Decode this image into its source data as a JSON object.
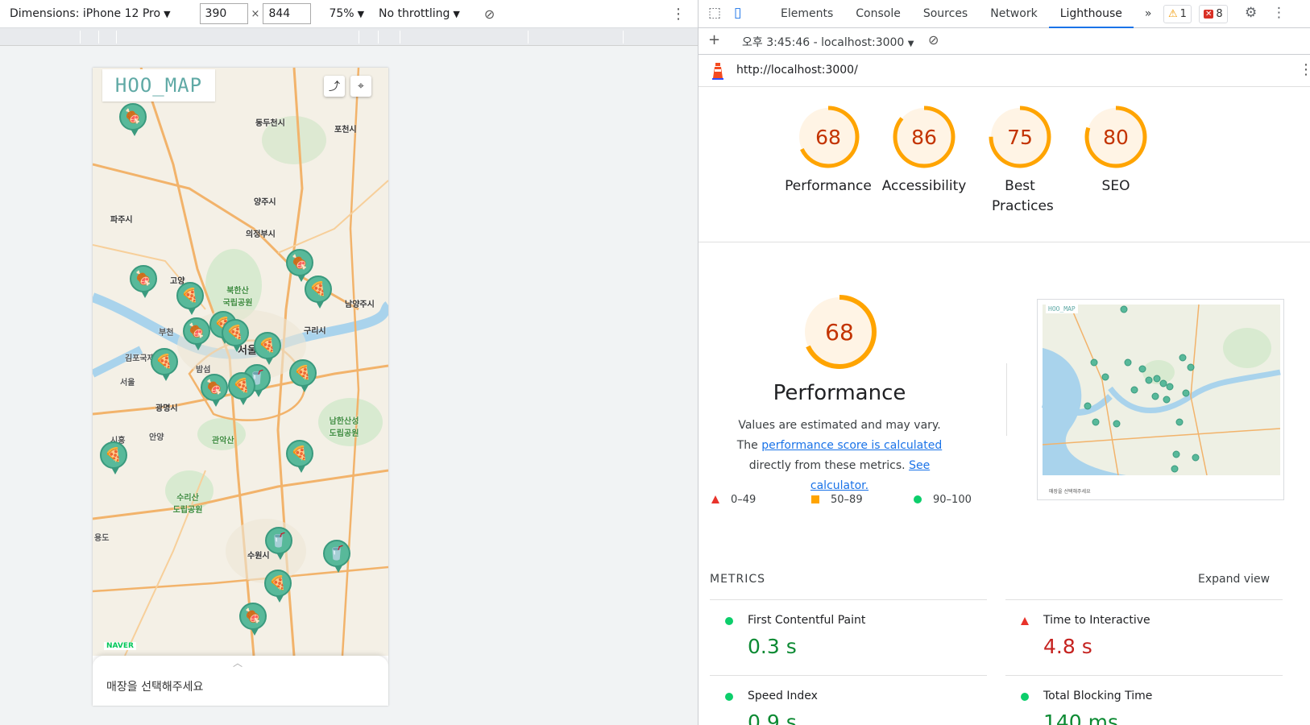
{
  "device_toolbar": {
    "dimensions_label": "Dimensions: iPhone 12 Pro",
    "width_value": "390",
    "height_value": "844",
    "times": "×",
    "zoom": "75%",
    "throttling": "No throttling"
  },
  "app": {
    "logo": "HOO_MAP",
    "share_icon": "share-icon",
    "location_icon": "location-icon",
    "naver_label": "NAVER",
    "bottom_sheet_message": "매장을 선택해주세요",
    "map_places": [
      "동두천시",
      "포천시",
      "양주시",
      "파주시",
      "의정부시",
      "고양",
      "북한산 국립공원",
      "남양주시",
      "구리시",
      "서울",
      "김포국제공항",
      "밤섬",
      "광명시",
      "관악산",
      "남한산성 도립공원",
      "안양",
      "수리산 도립공원",
      "수원시",
      "용도",
      "서울",
      "부천",
      "시흥"
    ],
    "pins": [
      {
        "icon": "🍖"
      },
      {
        "icon": "🍖"
      },
      {
        "icon": "🍕"
      },
      {
        "icon": "🍖"
      },
      {
        "icon": "🍕"
      },
      {
        "icon": "🍖"
      },
      {
        "icon": "🍕"
      },
      {
        "icon": "🍕"
      },
      {
        "icon": "🍕"
      },
      {
        "icon": "🍕"
      },
      {
        "icon": "🥤"
      },
      {
        "icon": "🍕"
      },
      {
        "icon": "🍖"
      },
      {
        "icon": "🍕"
      },
      {
        "icon": "🍕"
      },
      {
        "icon": "🍕"
      },
      {
        "icon": "🥤"
      },
      {
        "icon": "🥤"
      },
      {
        "icon": "🍕"
      },
      {
        "icon": "🍖"
      }
    ]
  },
  "devtools": {
    "tabs": [
      "Elements",
      "Console",
      "Sources",
      "Network",
      "Lighthouse"
    ],
    "active_tab": "Lighthouse",
    "more_tabs": "»",
    "warnings_count": "1",
    "errors_count": "8",
    "report_select": "오후 3:45:46 - localhost:3000",
    "add_label": "+",
    "url": "http://localhost:3000/"
  },
  "scores": [
    {
      "label": "Performance",
      "value": 68
    },
    {
      "label": "Accessibility",
      "value": 86
    },
    {
      "label": "Best Practices",
      "value": 75
    },
    {
      "label": "SEO",
      "value": 80
    }
  ],
  "performance": {
    "score": 68,
    "title": "Performance",
    "desc_prefix": "Values are estimated and may vary. The",
    "desc_link": "performance score is calculated",
    "desc_middle": "directly from these metrics.",
    "desc_calc_link": "See calculator.",
    "legend": [
      "0–49",
      "50–89",
      "90–100"
    ],
    "thumb_logo": "HOO_MAP",
    "thumb_message": "매장을 선택해주세요"
  },
  "metrics": {
    "title": "METRICS",
    "expand": "Expand view",
    "items": [
      {
        "name": "First Contentful Paint",
        "value": "0.3 s",
        "status": "good"
      },
      {
        "name": "Time to Interactive",
        "value": "4.8 s",
        "status": "poor"
      },
      {
        "name": "Speed Index",
        "value": "0.9 s",
        "status": "good"
      },
      {
        "name": "Total Blocking Time",
        "value": "140 ms",
        "status": "good"
      }
    ]
  },
  "colors": {
    "gauge_orange": "#ffa400",
    "gauge_text": "#c33300",
    "good": "#0cce6b",
    "poor": "#e8332b",
    "pin_green": "#58b99a",
    "link_blue": "#1a73e8"
  }
}
